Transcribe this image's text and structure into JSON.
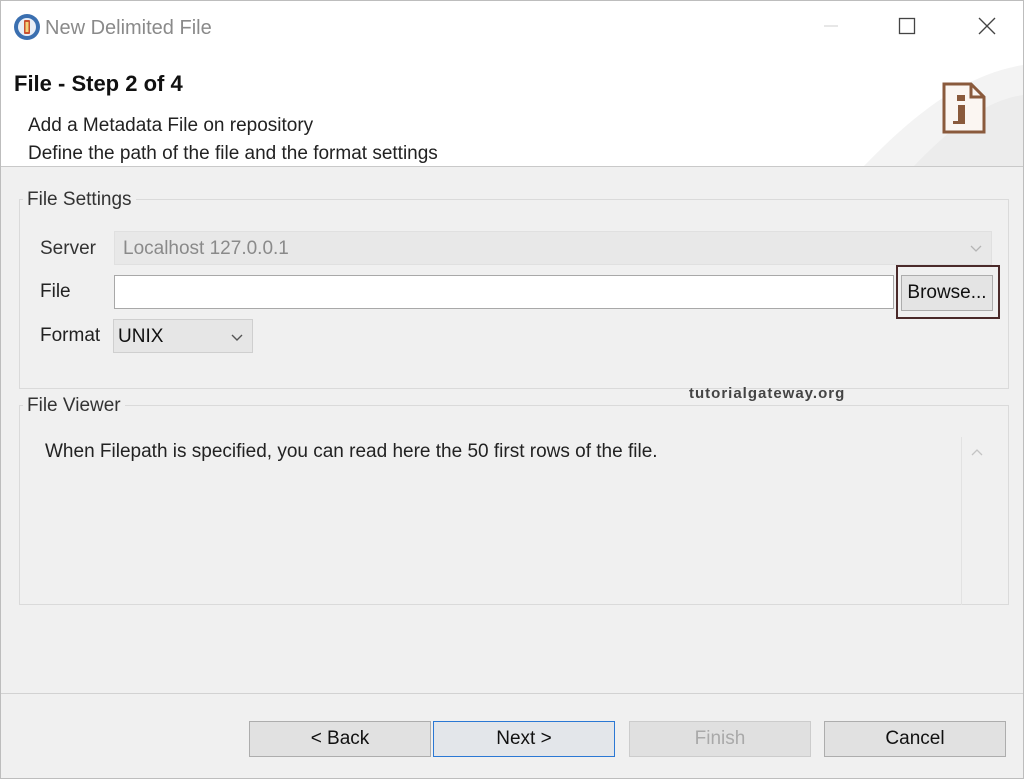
{
  "window": {
    "title": "New Delimited File"
  },
  "banner": {
    "step_title": "File - Step 2 of 4",
    "description_line1": "Add a Metadata File on repository",
    "description_line2": "Define the path of the file and the format settings"
  },
  "file_settings": {
    "group_label": "File Settings",
    "server_label": "Server",
    "server_value": "Localhost 127.0.0.1",
    "file_label": "File",
    "file_value": "",
    "browse_label": "Browse...",
    "format_label": "Format",
    "format_value": "UNIX"
  },
  "watermark": "tutorialgateway.org",
  "file_viewer": {
    "group_label": "File Viewer",
    "message": "When Filepath is specified, you can read here the 50 first rows of the file."
  },
  "footer": {
    "back_label": "< Back",
    "next_label": "Next >",
    "finish_label": "Finish",
    "cancel_label": "Cancel"
  },
  "icons": {
    "app": "talend-app-icon",
    "banner": "file-document-icon",
    "minimize": "minimize-icon",
    "maximize": "maximize-icon",
    "close": "close-icon"
  },
  "colors": {
    "accent_border": "#2b78d4",
    "highlight_outline": "#4a2a2a",
    "banner_icon": "#8a5a3c"
  }
}
